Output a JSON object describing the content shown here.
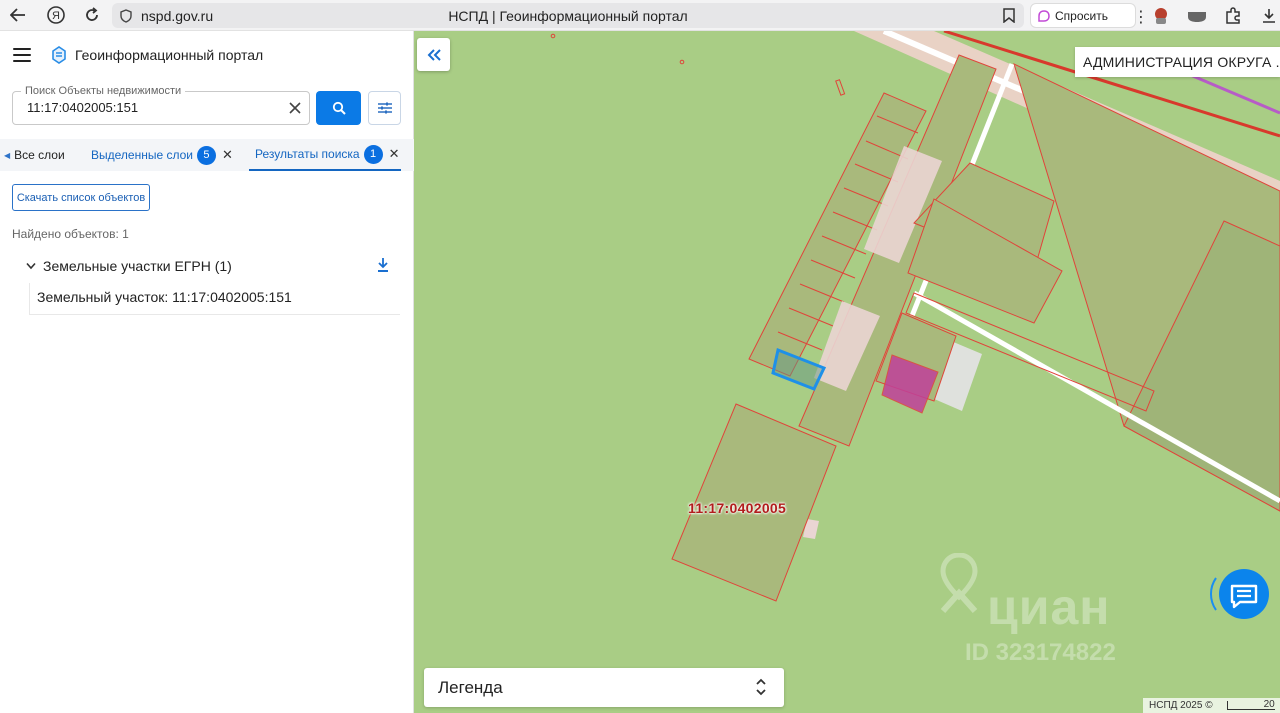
{
  "browser": {
    "url": "nspd.gov.ru",
    "page_title": "НСПД | Геоинформационный портал",
    "ask_label": "Спросить"
  },
  "panel": {
    "title": "Геоинформационный портал",
    "search": {
      "label": "Поиск Объекты недвижимости",
      "value": "11:17:0402005:151"
    },
    "tabs": {
      "all_layers": "Все слои",
      "selected_layers": "Выделенные слои",
      "selected_count": "5",
      "search_results": "Результаты поиска",
      "results_count": "1"
    },
    "download_button": "Скачать список объектов",
    "found_text": "Найдено объектов: 1",
    "group_label": "Земельные участки ЕГРН (1)",
    "result_item": "Земельный участок: 11:17:0402005:151"
  },
  "map": {
    "admin_label": "АДМИНИСТРАЦИЯ ОКРУГА ...",
    "cadastral_label": "11:17:0402005",
    "legend_label": "Легенда",
    "copyright": "НСПД 2025 ©",
    "scale_text": "20",
    "watermark_brand": "циан",
    "watermark_id": "ID 323174822",
    "colors": {
      "background": "#a9cd85",
      "parcel_border": "#e0443a",
      "selected_parcel": "#1e90e8",
      "highlight_parcel": "#c0409a",
      "accent": "#0b7ae6"
    }
  }
}
